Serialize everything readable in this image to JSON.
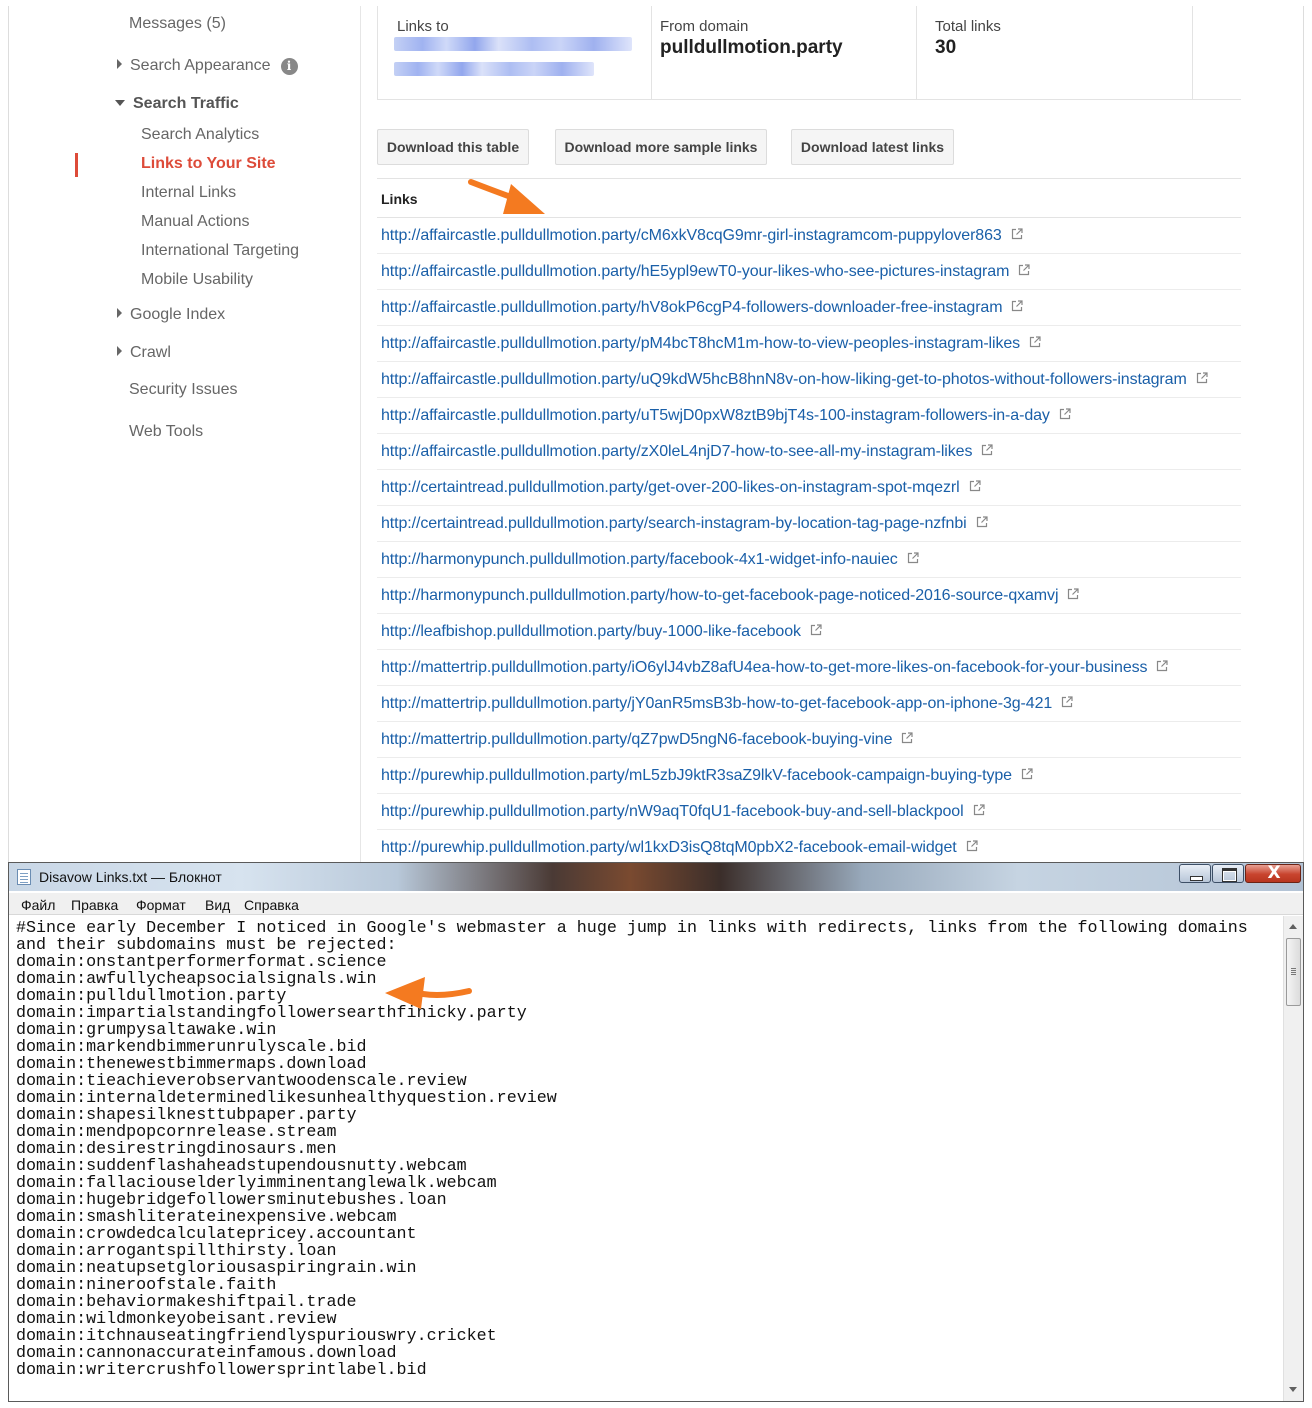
{
  "sidebar": {
    "messages": "Messages (5)",
    "search_appearance": "Search Appearance",
    "search_traffic": "Search Traffic",
    "search_analytics": "Search Analytics",
    "links_to_your_site": "Links to Your Site",
    "internal_links": "Internal Links",
    "manual_actions": "Manual Actions",
    "international_targeting": "International Targeting",
    "mobile_usability": "Mobile Usability",
    "google_index": "Google Index",
    "crawl": "Crawl",
    "security_issues": "Security Issues",
    "web_tools": "Web Tools"
  },
  "summary": {
    "links_to_label": "Links to",
    "from_domain_label": "From domain",
    "from_domain_value": "pulldullmotion.party",
    "total_links_label": "Total links",
    "total_links_value": "30"
  },
  "buttons": {
    "download_table": "Download this table",
    "download_sample": "Download more sample links",
    "download_latest": "Download latest links"
  },
  "links_header": "Links",
  "links": [
    "http://affaircastle.pulldullmotion.party/cM6xkV8cqG9mr-girl-instagramcom-puppylover863",
    "http://affaircastle.pulldullmotion.party/hE5ypl9ewT0-your-likes-who-see-pictures-instagram",
    "http://affaircastle.pulldullmotion.party/hV8okP6cgP4-followers-downloader-free-instagram",
    "http://affaircastle.pulldullmotion.party/pM4bcT8hcM1m-how-to-view-peoples-instagram-likes",
    "http://affaircastle.pulldullmotion.party/uQ9kdW5hcB8hnN8v-on-how-liking-get-to-photos-without-followers-instagram",
    "http://affaircastle.pulldullmotion.party/uT5wjD0pxW8ztB9bjT4s-100-instagram-followers-in-a-day",
    "http://affaircastle.pulldullmotion.party/zX0leL4njD7-how-to-see-all-my-instagram-likes",
    "http://certaintread.pulldullmotion.party/get-over-200-likes-on-instagram-spot-mqezrl",
    "http://certaintread.pulldullmotion.party/search-instagram-by-location-tag-page-nzfnbi",
    "http://harmonypunch.pulldullmotion.party/facebook-4x1-widget-info-nauiec",
    "http://harmonypunch.pulldullmotion.party/how-to-get-facebook-page-noticed-2016-source-qxamvj",
    "http://leafbishop.pulldullmotion.party/buy-1000-like-facebook",
    "http://mattertrip.pulldullmotion.party/iO6ylJ4vbZ8afU4ea-how-to-get-more-likes-on-facebook-for-your-business",
    "http://mattertrip.pulldullmotion.party/jY0anR5msB3b-how-to-get-facebook-app-on-iphone-3g-421",
    "http://mattertrip.pulldullmotion.party/qZ7pwD5ngN6-facebook-buying-vine",
    "http://purewhip.pulldullmotion.party/mL5zbJ9ktR3saZ9lkV-facebook-campaign-buying-type",
    "http://purewhip.pulldullmotion.party/nW9aqT0fqU1-facebook-buy-and-sell-blackpool",
    "http://purewhip.pulldullmotion.party/wl1kxD3isQ8tqM0pbX2-facebook-email-widget"
  ],
  "notepad": {
    "title": "Disavow Links.txt — Блокнот",
    "menu": [
      "Файл",
      "Правка",
      "Формат",
      "Вид",
      "Справка"
    ],
    "content": "#Since early December I noticed in Google's webmaster a huge jump in links with redirects, links from the following domains\nand their subdomains must be rejected:\ndomain:onstantperformerformat.science\ndomain:awfullycheapsocialsignals.win\ndomain:pulldullmotion.party\ndomain:impartialstandingfollowersearthfinicky.party\ndomain:grumpysaltawake.win\ndomain:markendbimmerunrulyscale.bid\ndomain:thenewestbimmermaps.download\ndomain:tieachieverobservantwoodenscale.review\ndomain:internaldeterminedlikesunhealthyquestion.review\ndomain:shapesilknesttubpaper.party\ndomain:mendpopcornrelease.stream\ndomain:desirestringdinosaurs.men\ndomain:suddenflashaheadstupendousnutty.webcam\ndomain:fallaciouselderlyimminentanglewalk.webcam\ndomain:hugebridgefollowersminutebushes.loan\ndomain:smashliterateinexpensive.webcam\ndomain:crowdedcalculatepricey.accountant\ndomain:arrogantspillthirsty.loan\ndomain:neatupsetgloriousaspiringrain.win\ndomain:nineroofstale.faith\ndomain:behaviormakeshiftpail.trade\ndomain:wildmonkeyobeisant.review\ndomain:itchnauseatingfriendlyspuriouswry.cricket\ndomain:cannonaccurateinfamous.download\ndomain:writercrushfollowersprintlabel.bid",
    "close_glyph": "X"
  },
  "colors": {
    "link": "#1a5fa8",
    "active_nav": "#dd4b39",
    "arrow": "#f47a20"
  }
}
